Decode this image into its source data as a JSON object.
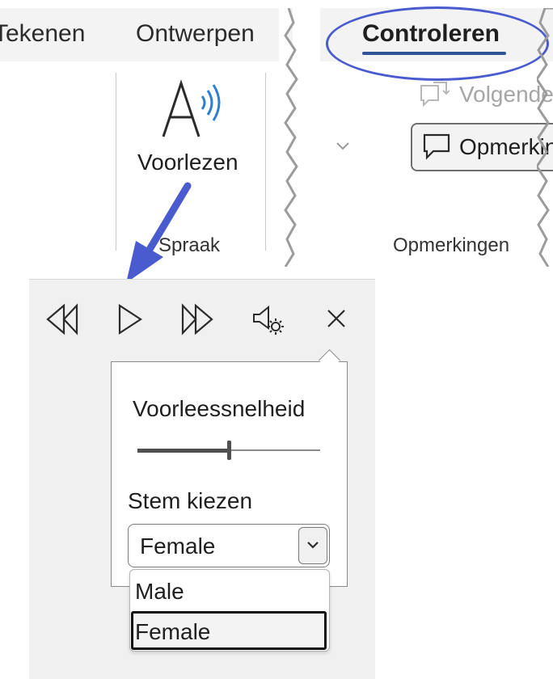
{
  "ribbon": {
    "tabs": [
      "Tekenen",
      "Ontwerpen",
      "Controleren"
    ],
    "active_tab": "Controleren",
    "read_aloud_label": "Voorlezen",
    "speech_group_label": "Spraak",
    "next_label": "Volgende",
    "comment_label": "Opmerking",
    "comments_group_label": "Opmerkingen"
  },
  "reader": {
    "speed_label": "Voorleessnelheid",
    "speed_value": 0.5,
    "voice_label": "Stem kiezen",
    "voice_selected": "Female",
    "voice_options": [
      "Male",
      "Female"
    ]
  },
  "colors": {
    "accent_blue": "#2f5597",
    "annotation_blue": "#4a5bd0",
    "speech_wave": "#2f7fd0"
  }
}
